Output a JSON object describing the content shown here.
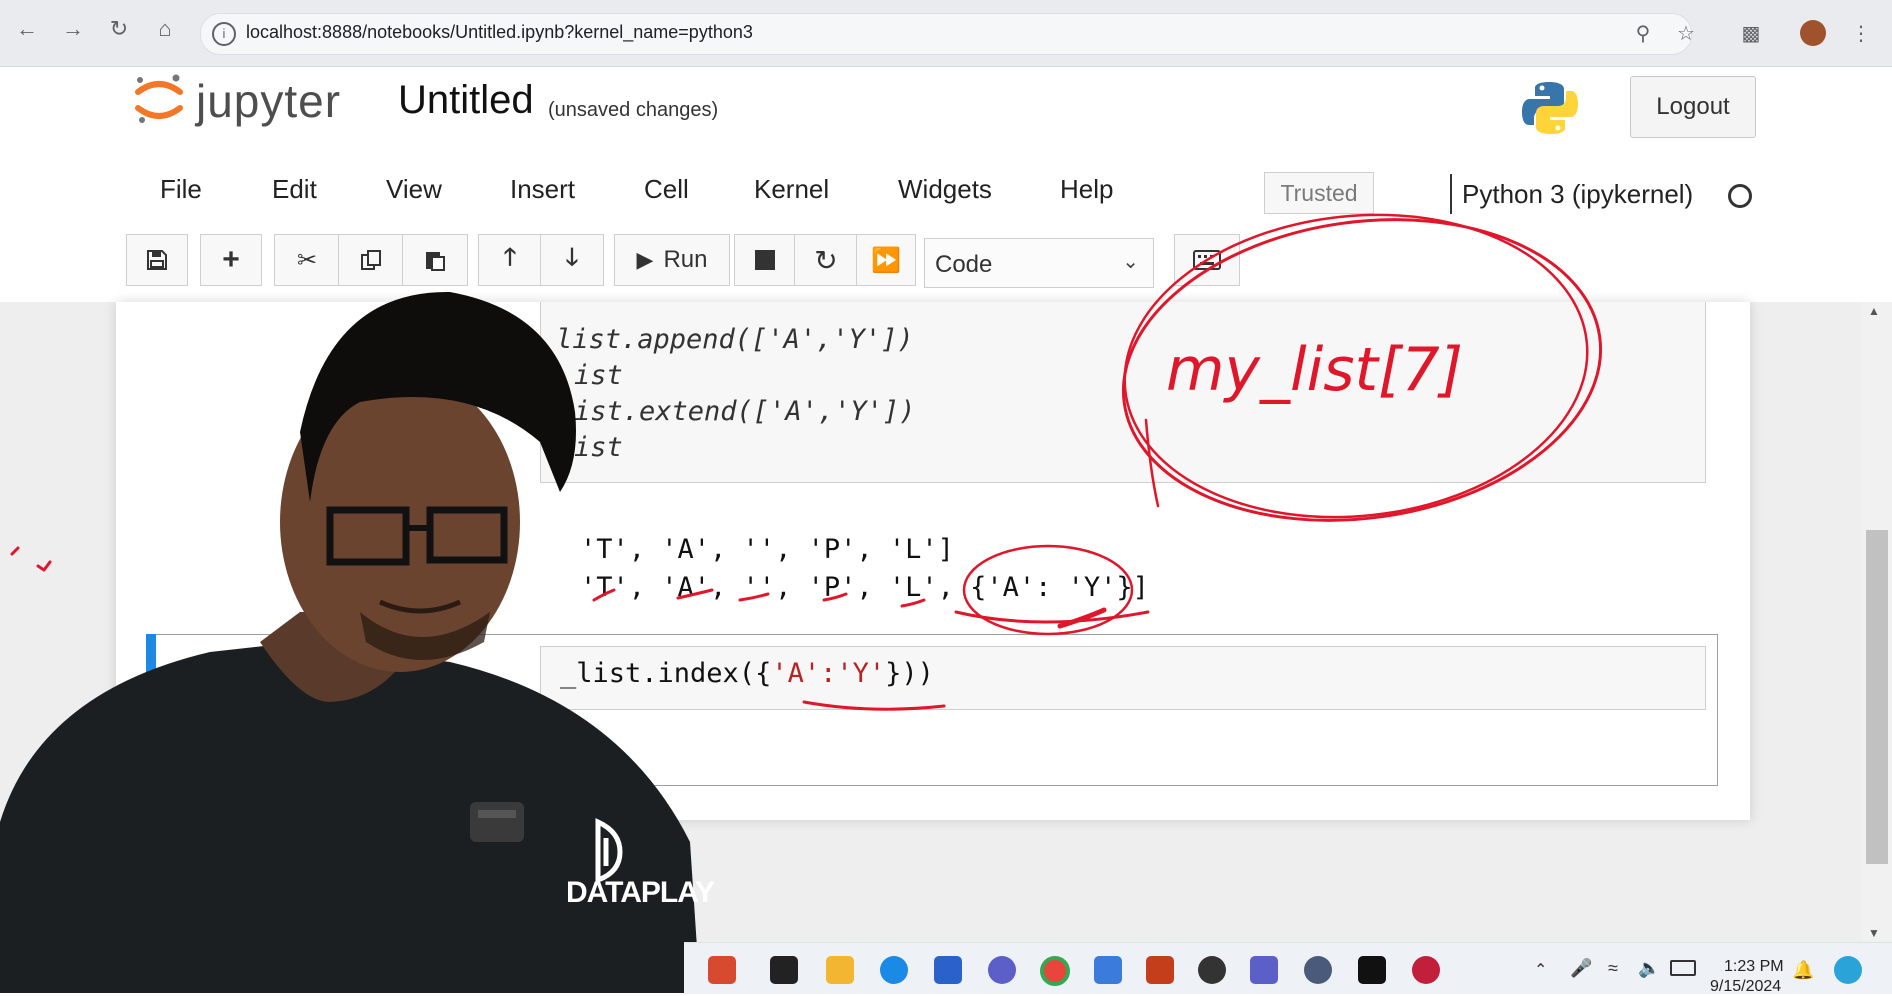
{
  "browser": {
    "url": "localhost:8888/notebooks/Untitled.ipynb?kernel_name=python3"
  },
  "header": {
    "wordmark": "jupyter",
    "notebook_title": "Untitled",
    "save_status": "(unsaved changes)",
    "logout_label": "Logout"
  },
  "menu": {
    "items": [
      "File",
      "Edit",
      "View",
      "Insert",
      "Cell",
      "Kernel",
      "Widgets",
      "Help"
    ],
    "trusted": "Trusted",
    "kernel": "Python 3 (ipykernel)"
  },
  "toolbar": {
    "run_label": "Run",
    "cell_type": "Code"
  },
  "cells": {
    "prev_code": [
      "list.append(['A','Y'])",
      "ist",
      "ist.extend(['A','Y'])",
      "ist"
    ],
    "outputs": [
      "'T', 'A', '', 'P', 'L']",
      "'T', 'A', '', 'P', 'L', {'A': 'Y'}]"
    ],
    "active_code_prefix": "_list.index({",
    "active_code_string": "'A':'Y'",
    "active_code_suffix": "}))"
  },
  "annotation": {
    "handwritten": "my_list[7]",
    "pen_color": "#e0162b"
  },
  "presenter": {
    "shirt_brand": "DATAPLAY"
  },
  "taskbar": {
    "time": "1:23 PM",
    "date": "9/15/2024"
  },
  "colors": {
    "accent_blue": "#1e88e5",
    "string_red": "#ba2121",
    "pen_red": "#e0162b"
  }
}
